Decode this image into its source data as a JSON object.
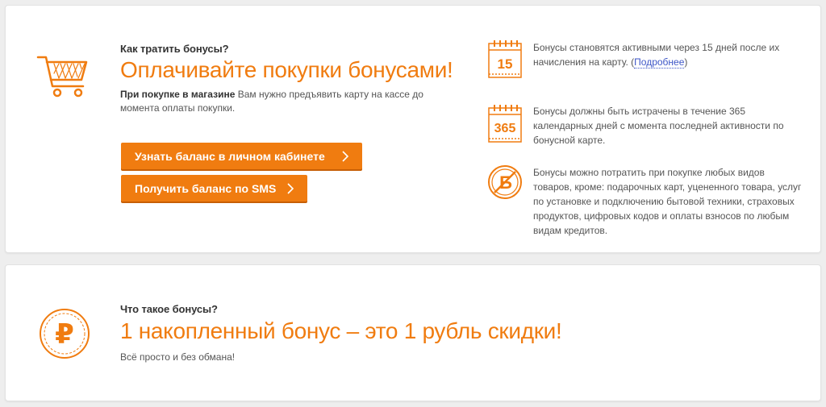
{
  "spend": {
    "kicker": "Как тратить бонусы?",
    "headline": "Оплачивайте покупки бонусами!",
    "desc_bold": "При покупке в магазине",
    "desc_text": " Вам нужно предъявить карту на кассе до момента оплаты покупки.",
    "buttons": [
      {
        "label": "Узнать баланс в личном кабинете"
      },
      {
        "label": "Получить баланс по SMS"
      }
    ]
  },
  "rules": [
    {
      "icon": "calendar-15-icon",
      "icon_text": "15",
      "text": "Бонусы становятся активными через 15 дней после их начисления на карту. (",
      "link": "Подробнее",
      "text_after": ")"
    },
    {
      "icon": "calendar-365-icon",
      "icon_text": "365",
      "text": "Бонусы должны быть истрачены в течение 365 календарных дней с момента последней активности по бонусной карте."
    },
    {
      "icon": "no-bonus-icon",
      "icon_text": "Б",
      "text": "Бонусы можно потратить при покупке любых видов товаров, кроме: подарочных карт, уцененного товара, услуг по установке и подключению бытовой техники, страховых продуктов, цифровых кодов и оплаты взносов по любым видам кредитов."
    }
  ],
  "about": {
    "kicker": "Что такое бонусы?",
    "headline": "1 накопленный бонус – это 1 рубль скидки!",
    "desc": "Всё просто и без обмана!",
    "icon_text": "₽"
  },
  "colors": {
    "accent": "#f07c10",
    "link": "#3d56c7"
  }
}
